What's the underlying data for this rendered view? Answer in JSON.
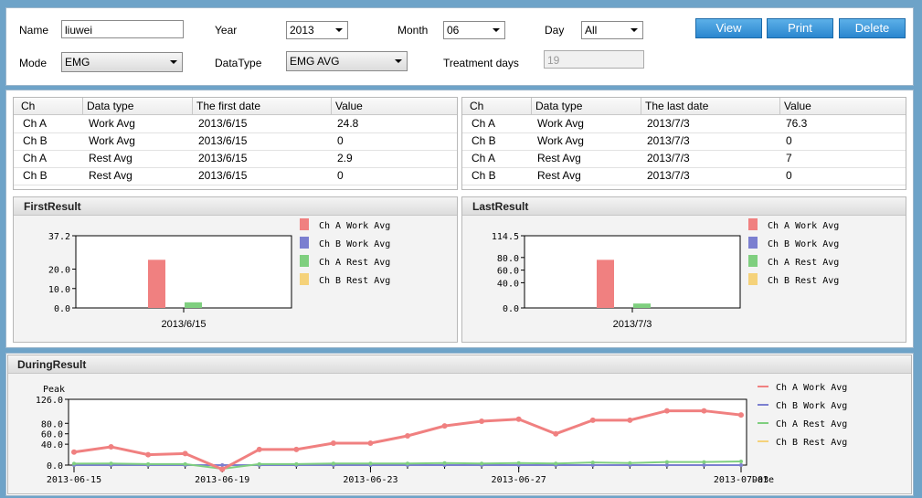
{
  "form": {
    "name_label": "Name",
    "name_value": "liuwei",
    "year_label": "Year",
    "year_value": "2013",
    "month_label": "Month",
    "month_value": "06",
    "day_label": "Day",
    "day_value": "All",
    "mode_label": "Mode",
    "mode_value": "EMG",
    "datatype_label": "DataType",
    "datatype_value": "EMG AVG",
    "treatment_label": "Treatment days",
    "treatment_value": "19"
  },
  "buttons": {
    "view": "View",
    "print": "Print",
    "delete": "Delete"
  },
  "first_table": {
    "headers": [
      "Ch",
      "Data type",
      "The first date",
      "Value"
    ],
    "rows": [
      [
        "Ch A",
        "Work Avg",
        "2013/6/15",
        "24.8"
      ],
      [
        "Ch B",
        "Work Avg",
        "2013/6/15",
        "0"
      ],
      [
        "Ch A",
        "Rest Avg",
        "2013/6/15",
        "2.9"
      ],
      [
        "Ch B",
        "Rest Avg",
        "2013/6/15",
        "0"
      ]
    ]
  },
  "last_table": {
    "headers": [
      "Ch",
      "Data type",
      "The last date",
      "Value"
    ],
    "rows": [
      [
        "Ch A",
        "Work Avg",
        "2013/7/3",
        "76.3"
      ],
      [
        "Ch B",
        "Work Avg",
        "2013/7/3",
        "0"
      ],
      [
        "Ch A",
        "Rest Avg",
        "2013/7/3",
        "7"
      ],
      [
        "Ch B",
        "Rest Avg",
        "2013/7/3",
        "0"
      ]
    ]
  },
  "legend": [
    "Ch A Work Avg",
    "Ch B Work Avg",
    "Ch A Rest Avg",
    "Ch B Rest Avg"
  ],
  "colors": {
    "ch_a_work": "#f08080",
    "ch_b_work": "#7b7fd0",
    "ch_a_rest": "#7fcf7f",
    "ch_b_rest": "#f5d27a"
  },
  "chart_data": [
    {
      "type": "bar",
      "title": "FirstResult",
      "categories": [
        "2013/6/15"
      ],
      "series": [
        {
          "name": "Ch A Work Avg",
          "values": [
            24.8
          ]
        },
        {
          "name": "Ch B Work Avg",
          "values": [
            0
          ]
        },
        {
          "name": "Ch A Rest Avg",
          "values": [
            2.9
          ]
        },
        {
          "name": "Ch B Rest Avg",
          "values": [
            0
          ]
        }
      ],
      "yticks": [
        "37.2",
        "20.0",
        "10.0",
        "0.0"
      ],
      "ylim": [
        0,
        37.2
      ],
      "legend": "right"
    },
    {
      "type": "bar",
      "title": "LastResult",
      "categories": [
        "2013/7/3"
      ],
      "series": [
        {
          "name": "Ch A Work Avg",
          "values": [
            76.3
          ]
        },
        {
          "name": "Ch B Work Avg",
          "values": [
            0
          ]
        },
        {
          "name": "Ch A Rest Avg",
          "values": [
            7
          ]
        },
        {
          "name": "Ch B Rest Avg",
          "values": [
            0
          ]
        }
      ],
      "yticks": [
        "114.5",
        "80.0",
        "60.0",
        "40.0",
        "0.0"
      ],
      "ylim": [
        0,
        114.5
      ],
      "legend": "right"
    },
    {
      "type": "line",
      "title": "DuringResult",
      "ylabel": "Peak",
      "xlabel": "Date",
      "x": [
        "2013-06-15",
        "2013-06-16",
        "2013-06-17",
        "2013-06-18",
        "2013-06-19",
        "2013-06-20",
        "2013-06-21",
        "2013-06-22",
        "2013-06-23",
        "2013-06-24",
        "2013-06-25",
        "2013-06-26",
        "2013-06-27",
        "2013-06-28",
        "2013-06-29",
        "2013-06-30",
        "2013-07-01",
        "2013-07-02",
        "2013-07-03"
      ],
      "xticks": [
        "2013-06-15",
        "2013-06-19",
        "2013-06-23",
        "2013-06-27",
        "2013-07-03"
      ],
      "yticks": [
        "126.0",
        "80.0",
        "60.0",
        "40.0",
        "0.0"
      ],
      "ylim": [
        0,
        126
      ],
      "series": [
        {
          "name": "Ch A Work Avg",
          "values": [
            25,
            35,
            20,
            22,
            -8,
            30,
            30,
            42,
            42,
            56,
            75,
            84,
            88,
            60,
            86,
            86,
            104,
            104,
            96
          ]
        },
        {
          "name": "Ch B Work Avg",
          "values": [
            0,
            0,
            0,
            0,
            0,
            0,
            0,
            0,
            0,
            0,
            0,
            0,
            0,
            0,
            0,
            0,
            0,
            0,
            0
          ]
        },
        {
          "name": "Ch A Rest Avg",
          "values": [
            2.9,
            3,
            2,
            2,
            -7,
            2,
            2,
            3,
            3,
            3,
            4,
            3,
            4,
            3,
            5,
            4,
            6,
            6,
            7
          ]
        },
        {
          "name": "Ch B Rest Avg",
          "values": [
            0,
            0,
            0,
            0,
            0,
            0,
            0,
            0,
            0,
            0,
            0,
            0,
            0,
            0,
            0,
            0,
            0,
            0,
            0
          ]
        }
      ],
      "legend": "right"
    }
  ]
}
